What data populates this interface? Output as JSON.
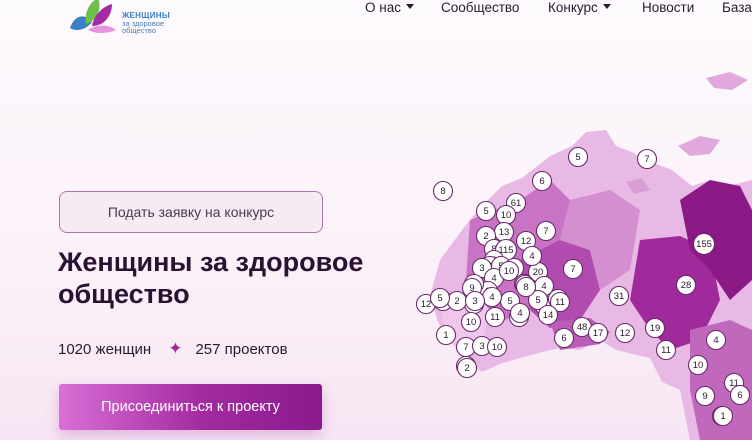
{
  "logo": {
    "line1": "ЖЕНЩИНЫ",
    "line2": "за здоровое",
    "line3": "общество"
  },
  "nav": {
    "items": [
      {
        "label": "О нас",
        "has_dropdown": true
      },
      {
        "label": "Сообщество",
        "has_dropdown": false
      },
      {
        "label": "Конкурс",
        "has_dropdown": true
      },
      {
        "label": "Новости",
        "has_dropdown": false
      },
      {
        "label": "База",
        "has_dropdown": false
      }
    ]
  },
  "hero": {
    "apply_label": "Подать заявку на конкурс",
    "title": "Женщины за здоровое общество",
    "women_count": "1020 женщин",
    "projects_count": "257 проектов",
    "join_label": "Присоединиться к проекту"
  },
  "map": {
    "markers": [
      "8",
      "5",
      "6",
      "7",
      "61",
      "5",
      "10",
      "13",
      "2",
      "7",
      "12",
      "8",
      "115",
      "2",
      "3",
      "5",
      "20",
      "4",
      "7",
      "5",
      "3",
      "3",
      "4",
      "10",
      "2",
      "5",
      "3",
      "4",
      "5",
      "4",
      "9",
      "4",
      "5",
      "8",
      "31",
      "28",
      "12",
      "5",
      "2",
      "3",
      "10",
      "5",
      "11",
      "11",
      "5",
      "11",
      "4",
      "14",
      "48",
      "17",
      "12",
      "19",
      "6",
      "4",
      "1",
      "7",
      "3",
      "10",
      "11",
      "2",
      "155",
      "10",
      "1",
      "11",
      "9",
      "6",
      "1",
      "2",
      "5",
      "8"
    ]
  },
  "colors": {
    "accent": "#a22aa0",
    "map_dark": "#8b1a86",
    "map_light": "#e8b2e3"
  }
}
